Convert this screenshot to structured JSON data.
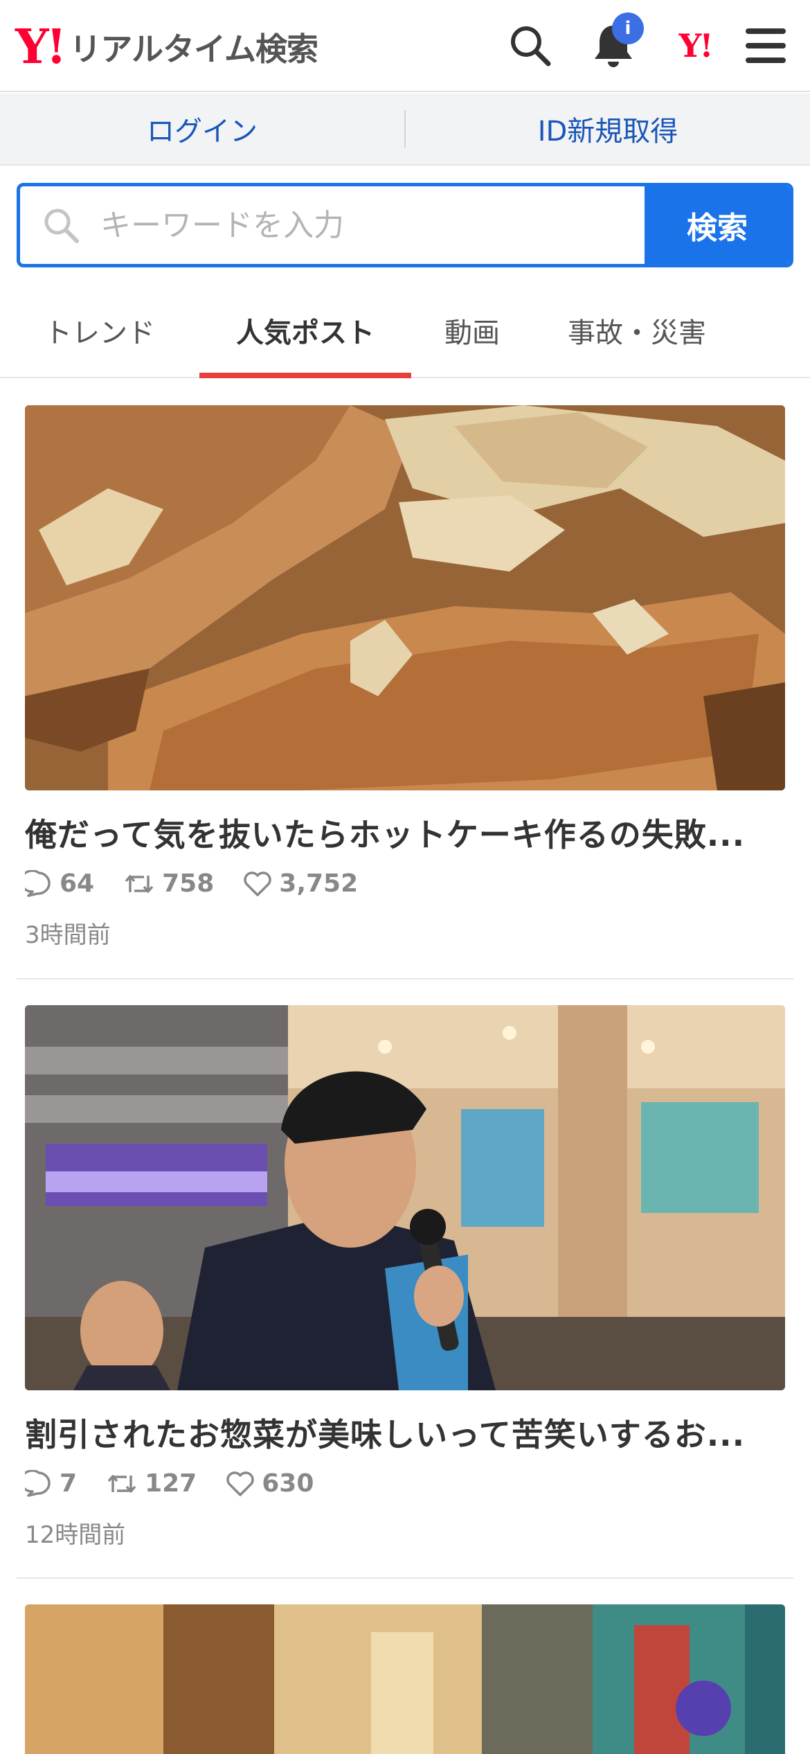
{
  "header": {
    "logo": "Y!",
    "title": "リアルタイム検索",
    "notification_badge": "i",
    "yahoo_mark": "Y!"
  },
  "loginbar": {
    "login": "ログイン",
    "register": "ID新規取得"
  },
  "search": {
    "placeholder": "キーワードを入力",
    "button": "検索"
  },
  "tabs": [
    {
      "label": "トレンド",
      "active": false
    },
    {
      "label": "人気ポスト",
      "active": true
    },
    {
      "label": "動画",
      "active": false
    },
    {
      "label": "事故・災害",
      "active": false
    }
  ],
  "posts": [
    {
      "title": "俺だって気を抜いたらホットケーキ作るの失敗...",
      "replies": "64",
      "reposts": "758",
      "likes": "3,752",
      "time": "3時間前"
    },
    {
      "title": "割引されたお惣菜が美味しいって苦笑いするお...",
      "replies": "7",
      "reposts": "127",
      "likes": "630",
      "time": "12時間前"
    }
  ],
  "colors": {
    "accent_blue": "#1a73e8",
    "brand_red": "#ff0033",
    "tab_underline": "#e8403d",
    "link_blue": "#1a56b8"
  }
}
